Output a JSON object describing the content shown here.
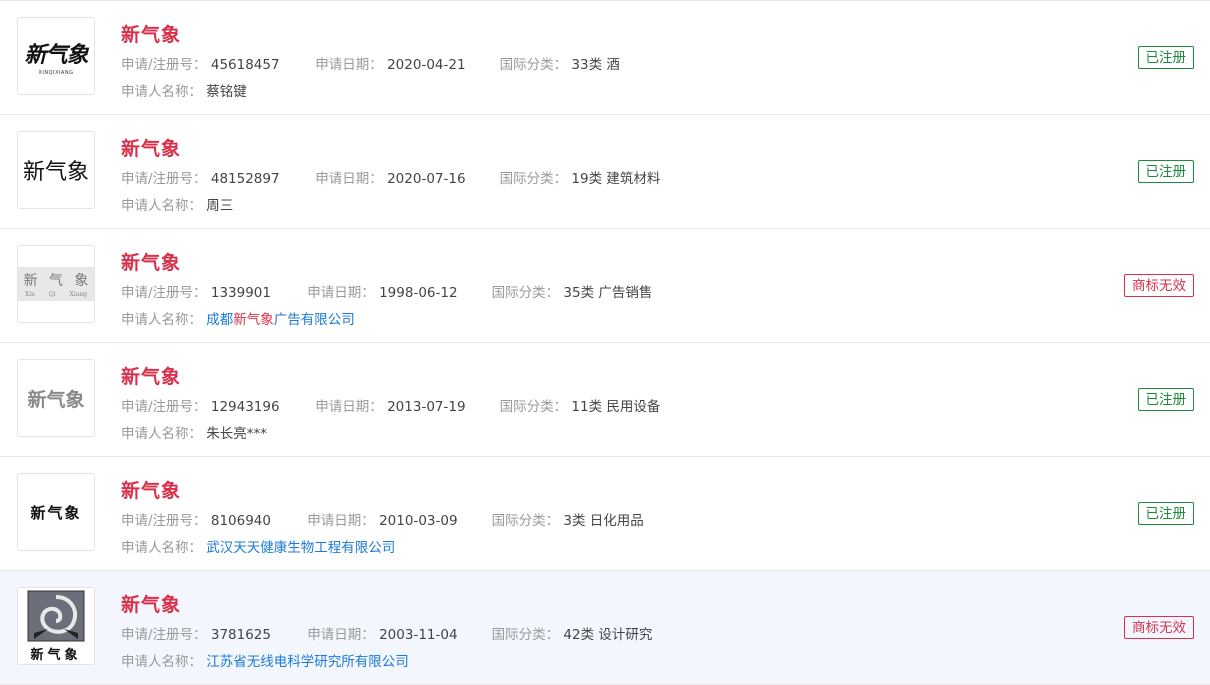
{
  "labels": {
    "reg_no": "申请/注册号：",
    "date": "申请日期：",
    "class": "国际分类：",
    "applicant": "申请人名称："
  },
  "colors": {
    "title": "#d9304b",
    "registered": "#1e8a3c",
    "invalid": "#d9304b",
    "link": "#1a7ad6"
  },
  "items": [
    {
      "title": "新气象",
      "logo_text": "新气象",
      "logo_sub": "XINQIXIANG",
      "reg_no": "45618457",
      "date": "2020-04-21",
      "class": "33类 酒",
      "applicant": "蔡铭键",
      "status": "已注册"
    },
    {
      "title": "新气象",
      "logo_text": "新气象",
      "reg_no": "48152897",
      "date": "2020-07-16",
      "class": "19类 建筑材料",
      "applicant": "周三",
      "status": "已注册"
    },
    {
      "title": "新气象",
      "logo_chars": [
        "新",
        "气",
        "象"
      ],
      "logo_pinyin": [
        "Xin",
        "Qi",
        "Xiang"
      ],
      "reg_no": "1339901",
      "date": "1998-06-12",
      "class": "35类 广告销售",
      "applicant_pre": "成都",
      "applicant_hit": "新气象",
      "applicant_post": "广告有限公司",
      "status": "商标无效"
    },
    {
      "title": "新气象",
      "logo_text": "新气象",
      "reg_no": "12943196",
      "date": "2013-07-19",
      "class": "11类 民用设备",
      "applicant": "朱长亮***",
      "status": "已注册"
    },
    {
      "title": "新气象",
      "logo_text": "新气象",
      "reg_no": "8106940",
      "date": "2010-03-09",
      "class": "3类 日化用品",
      "applicant": "武汉天天健康生物工程有限公司",
      "status": "已注册"
    },
    {
      "title": "新气象",
      "logo_text": "新气象",
      "reg_no": "3781625",
      "date": "2003-11-04",
      "class": "42类 设计研究",
      "applicant": "江苏省无线电科学研究所有限公司",
      "status": "商标无效"
    }
  ]
}
